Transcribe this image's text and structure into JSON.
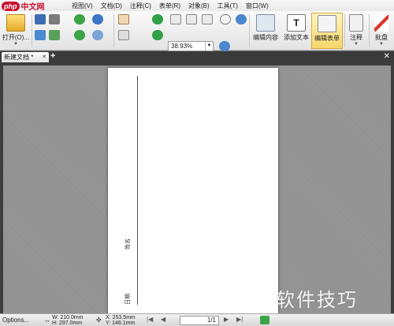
{
  "menubar": {
    "logo_brand": "php",
    "logo_text": "中文网",
    "items": [
      "视图(V)",
      "文档(D)",
      "注释(C)",
      "表单(R)",
      "对象(B)",
      "工具(T)",
      "窗口(W)"
    ]
  },
  "toolbar": {
    "open_label": "打开(O)...",
    "zoom_value": "38.93%",
    "edit_content_label": "编辑内容",
    "add_text_label": "添加文本",
    "edit_form_label": "编辑表单",
    "annotate_label": "注释",
    "sign_label": "批盘"
  },
  "tabs": {
    "doc_tab_label": "新建文档 *"
  },
  "statusbar": {
    "options_label": "Options...",
    "width_text": "W: 210.0mm",
    "height_text": "H: 297.0mm",
    "x_text": "X: 253.5mm",
    "y_text": "Y: 146.1mm",
    "page_text": "1/1"
  },
  "document": {
    "handwriting_1": "姓名",
    "handwriting_2": "日期"
  },
  "watermark": "软件技巧",
  "colors": {
    "brand_red": "#c8102e",
    "highlight": "#f6d66a",
    "canvas_gray": "#929292"
  }
}
